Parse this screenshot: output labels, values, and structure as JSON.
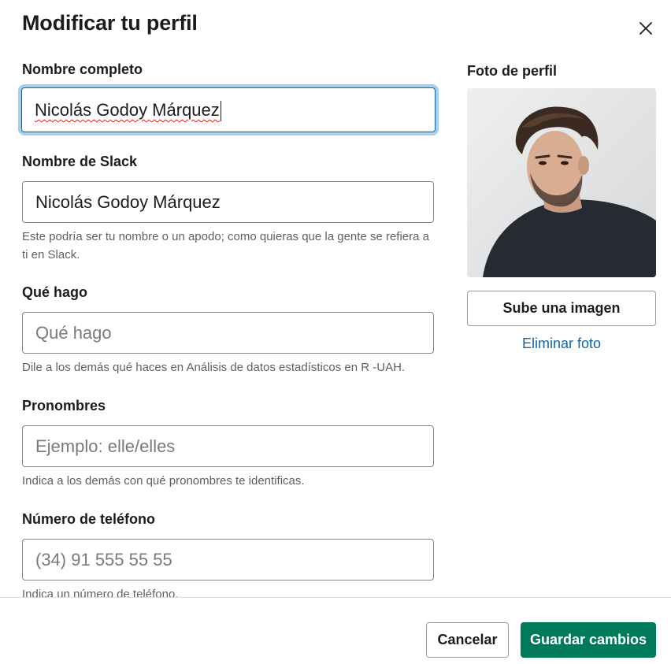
{
  "modal": {
    "title": "Modificar tu perfil"
  },
  "form": {
    "full_name": {
      "label": "Nombre completo",
      "value": "Nicolás Godoy Márquez"
    },
    "slack_name": {
      "label": "Nombre de Slack",
      "value": "Nicolás Godoy Márquez",
      "hint": "Este podría ser tu nombre o un apodo; como quieras que la gente se refiera a ti en Slack."
    },
    "what_i_do": {
      "label": "Qué hago",
      "placeholder": "Qué hago",
      "hint": "Dile a los demás qué haces en Análisis de datos estadísticos en R -UAH."
    },
    "pronouns": {
      "label": "Pronombres",
      "placeholder": "Ejemplo: elle/elles",
      "hint": "Indica a los demás con qué pronombres te identificas."
    },
    "phone": {
      "label": "Número de teléfono",
      "placeholder": "(34) 91 555 55 55",
      "hint": "Indica un número de teléfono."
    }
  },
  "photo": {
    "label": "Foto de perfil",
    "upload_label": "Sube una imagen",
    "remove_label": "Eliminar foto"
  },
  "footer": {
    "cancel_label": "Cancelar",
    "save_label": "Guardar cambios"
  },
  "colors": {
    "accent": "#1264a3",
    "focus_ring": "#a5cfee",
    "save": "#007a5a"
  },
  "icons": {
    "close": "close-icon"
  }
}
